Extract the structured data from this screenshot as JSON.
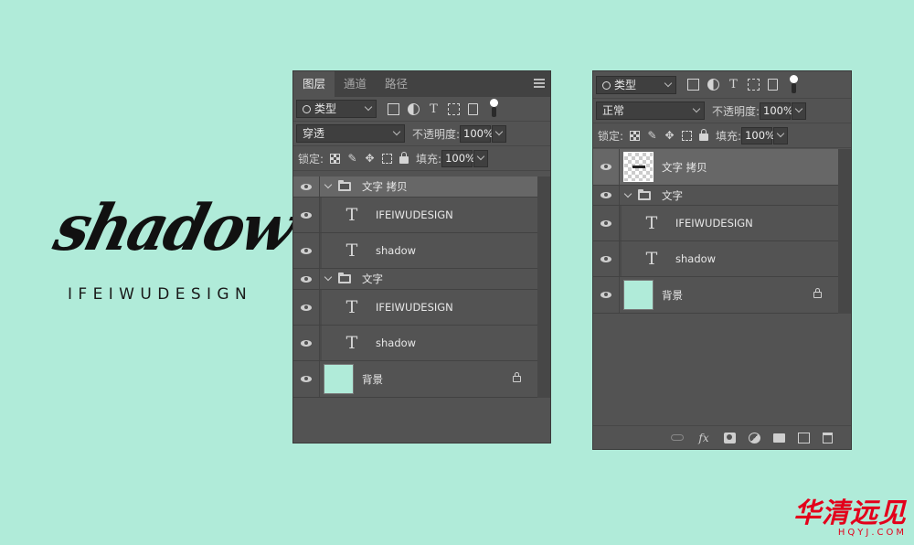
{
  "artwork": {
    "title": "shadow",
    "subtitle": "IFEIWUDESIGN"
  },
  "panel_left": {
    "tabs": [
      {
        "label": "图层",
        "active": true
      },
      {
        "label": "通道",
        "active": false
      },
      {
        "label": "路径",
        "active": false
      }
    ],
    "filter_kind": "类型",
    "blend_mode": "穿透",
    "opacity_label": "不透明度:",
    "opacity_value": "100%",
    "lock_label": "锁定:",
    "fill_label": "填充:",
    "fill_value": "100%",
    "layers": [
      {
        "type": "group",
        "name": "文字 拷贝",
        "expanded": true,
        "selected": true
      },
      {
        "type": "text",
        "name": "IFEIWUDESIGN"
      },
      {
        "type": "text",
        "name": "shadow"
      },
      {
        "type": "group",
        "name": "文字",
        "expanded": true
      },
      {
        "type": "text",
        "name": "IFEIWUDESIGN"
      },
      {
        "type": "text",
        "name": "shadow"
      },
      {
        "type": "background",
        "name": "背景",
        "locked": true
      }
    ]
  },
  "panel_right": {
    "filter_kind": "类型",
    "blend_mode": "正常",
    "opacity_label": "不透明度:",
    "opacity_value": "100%",
    "lock_label": "锁定:",
    "fill_label": "填充:",
    "fill_value": "100%",
    "layers": [
      {
        "type": "smart",
        "name": "文字 拷贝",
        "selected": true
      },
      {
        "type": "group",
        "name": "文字",
        "expanded": true
      },
      {
        "type": "text",
        "name": "IFEIWUDESIGN"
      },
      {
        "type": "text",
        "name": "shadow"
      },
      {
        "type": "background",
        "name": "背景",
        "locked": true
      }
    ]
  },
  "icons": {
    "text_glyph": "T"
  },
  "watermark": {
    "main": "华清远见",
    "sub": "HQYJ.COM"
  },
  "colors": {
    "canvas_bg": "#b0ebd9",
    "panel_bg": "#535353",
    "selected_row": "#676767",
    "watermark": "#e3001b"
  }
}
